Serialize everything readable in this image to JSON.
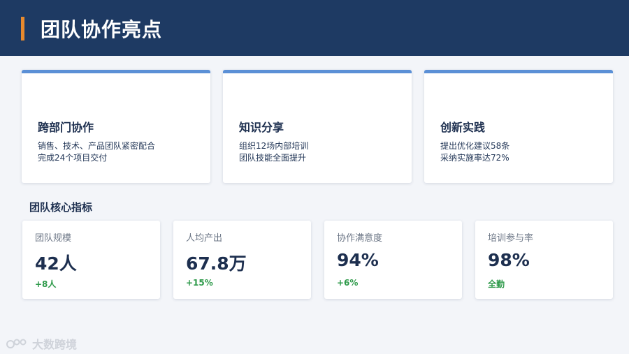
{
  "header": {
    "title": "团队协作亮点",
    "accent_color": "#e88a2e",
    "background": "#1e3a63"
  },
  "highlights": [
    {
      "title": "跨部门协作",
      "line1": "销售、技术、产品团队紧密配合",
      "line2": "完成24个项目交付"
    },
    {
      "title": "知识分享",
      "line1": "组织12场内部培训",
      "line2": "团队技能全面提升"
    },
    {
      "title": "创新实践",
      "line1": "提出优化建议58条",
      "line2": "采纳实施率达72%"
    }
  ],
  "metrics_section": {
    "title": "团队核心指标"
  },
  "metrics": [
    {
      "label": "团队规模",
      "value": "42人",
      "change": "+8人"
    },
    {
      "label": "人均产出",
      "value": "67.8万",
      "change": "+15%"
    },
    {
      "label": "协作满意度",
      "value": "94%",
      "change": "+6%"
    },
    {
      "label": "培训参与率",
      "value": "98%",
      "change": "全勤"
    }
  ],
  "watermark": {
    "text": "大数跨境",
    "icon": "brand-logo-icon"
  },
  "colors": {
    "card_top_border": "#5b90d6",
    "positive": "#2e9a4a",
    "text_dark": "#1d2f4f"
  }
}
